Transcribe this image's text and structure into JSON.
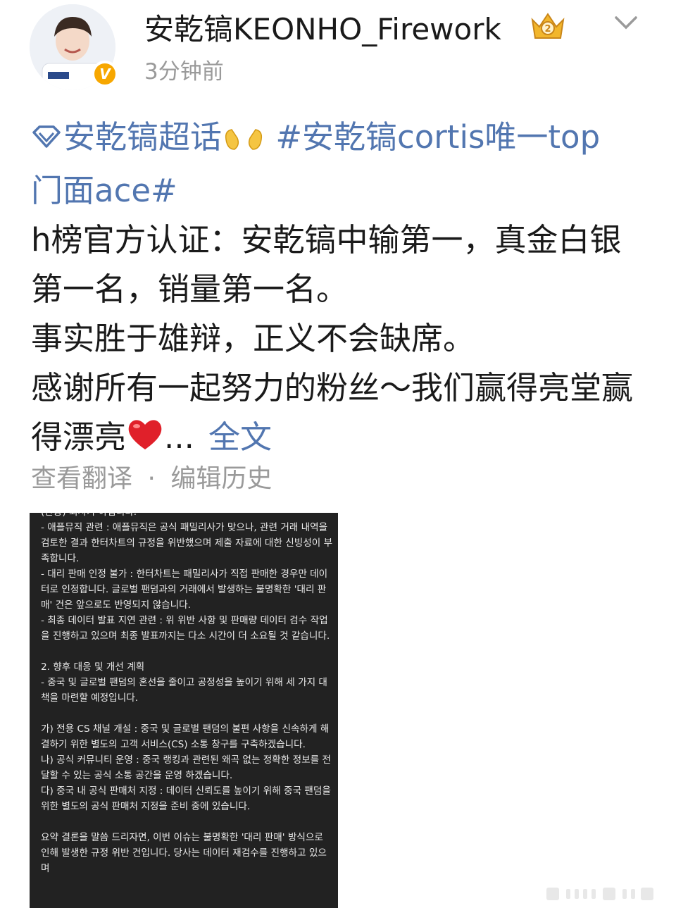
{
  "header": {
    "username": "安乾镐KEONHO_Firework",
    "time": "3分钟前",
    "avatar_icon": "avatar-photo",
    "verified_icon": "verified-v-icon",
    "crown_icon": "crown-badge-icon",
    "more_icon": "chevron-down-icon"
  },
  "post": {
    "supertopic": "安乾镐超话",
    "hashtag_line1": "#安乾镐cortis唯一top",
    "hashtag_line2": "门面ace#",
    "para1": "h榜官方认证：安乾镐中输第一，真金白银第一名，销量第一名。",
    "para2": "事实胜于雄辩，正义不会缺席。",
    "para3": "感谢所有一起努力的粉丝～我们赢得亮堂赢得漂亮",
    "ellipsis": "...",
    "full_text": "全文",
    "translate": "查看翻译",
    "separator": "·",
    "edit_history": "编辑历史"
  },
  "image": {
    "text": "(한중) 회사가 아닙니다.\n- 애플뮤직 관련 : 애플뮤직은 공식 패밀리사가 맞으나, 관련 거래 내역을 검토한 결과 한터차트의 규정을 위반했으며 제출 자료에 대한 신빙성이 부족합니다.\n- 대리 판매 인정 불가 : 한터차트는 패밀리사가 직접 판매한 경우만 데이터로 인정합니다. 글로벌 팬덤과의 거래에서 발생하는 불명확한 '대리 판매' 건은 앞으로도 반영되지 않습니다.\n- 최종 데이터 발표 지연 관련 : 위 위반 사항 및 판매량 데이터 검수 작업을 진행하고 있으며 최종 발표까지는 다소 시간이 더 소요될 것 같습니다.\n\n2. 향후 대응 및 개선 계획\n- 중국 및 글로벌 팬덤의 혼선을 줄이고 공정성을 높이기 위해 세 가지 대책을 마련할 예정입니다.\n\n가) 전용 CS 채널 개설 : 중국 및 글로벌 팬덤의 불편 사항을 신속하게 해결하기 위한 별도의 고객 서비스(CS) 소통 창구를 구축하겠습니다.\n나) 공식 커뮤니티 운영 : 중국 랭킹과 관련된 왜곡 없는 정확한 정보를 전달할 수 있는 공식 소통 공간을 운영 하겠습니다.\n다) 중국 내 공식 판매처 지정 : 데이터 신뢰도를 높이기 위해 중국 팬덤을 위한 별도의 공식 판매처 지정을 준비 중에 있습니다.\n\n요약 결론을 말씀 드리자면, 이번 이슈는 불명확한 '대리 판매' 방식으로 인해 발생한 규정 위반 건입니다. 당사는 데이터 재검수를 진행하고 있으며"
  },
  "colors": {
    "link": "#5276b0",
    "muted": "#9a9a9a",
    "text": "#1a1a1a",
    "badge": "#f7a700"
  }
}
